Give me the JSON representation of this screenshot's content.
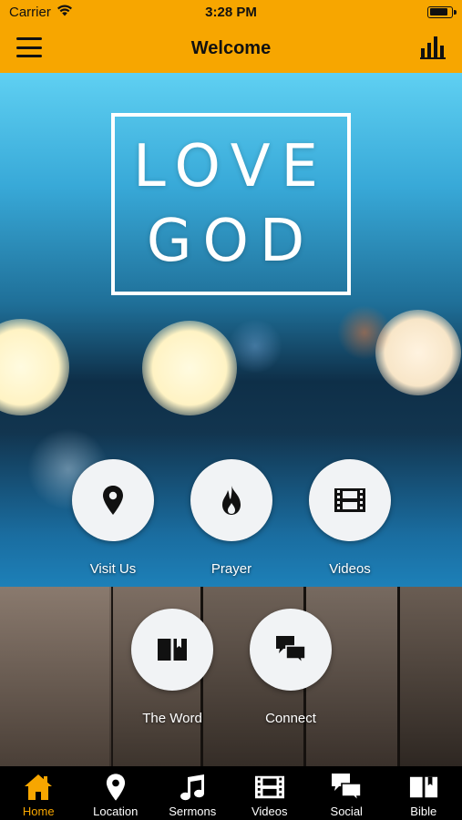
{
  "status_bar": {
    "carrier": "Carrier",
    "time": "3:28 PM",
    "battery_level": 0.85
  },
  "nav_bar": {
    "title": "Welcome",
    "left_icon": "menu-icon",
    "right_icon": "bar-chart-icon"
  },
  "hero": {
    "line1": "LOVE",
    "line2": "GOD"
  },
  "actions": [
    {
      "label": "Visit Us",
      "icon": "location-pin-icon"
    },
    {
      "label": "Prayer",
      "icon": "flame-icon"
    },
    {
      "label": "Videos",
      "icon": "film-icon"
    },
    {
      "label": "The Word",
      "icon": "book-icon"
    },
    {
      "label": "Connect",
      "icon": "chat-bubbles-icon"
    }
  ],
  "tabs": [
    {
      "label": "Home",
      "icon": "home-icon",
      "active": true
    },
    {
      "label": "Location",
      "icon": "location-pin-icon",
      "active": false
    },
    {
      "label": "Sermons",
      "icon": "music-note-icon",
      "active": false
    },
    {
      "label": "Videos",
      "icon": "film-icon",
      "active": false
    },
    {
      "label": "Social",
      "icon": "chat-bubbles-icon",
      "active": false
    },
    {
      "label": "Bible",
      "icon": "book-icon",
      "active": false
    }
  ],
  "colors": {
    "accent": "#f7a600",
    "tab_bar": "#000000",
    "button_circle": "#f1f3f5"
  }
}
